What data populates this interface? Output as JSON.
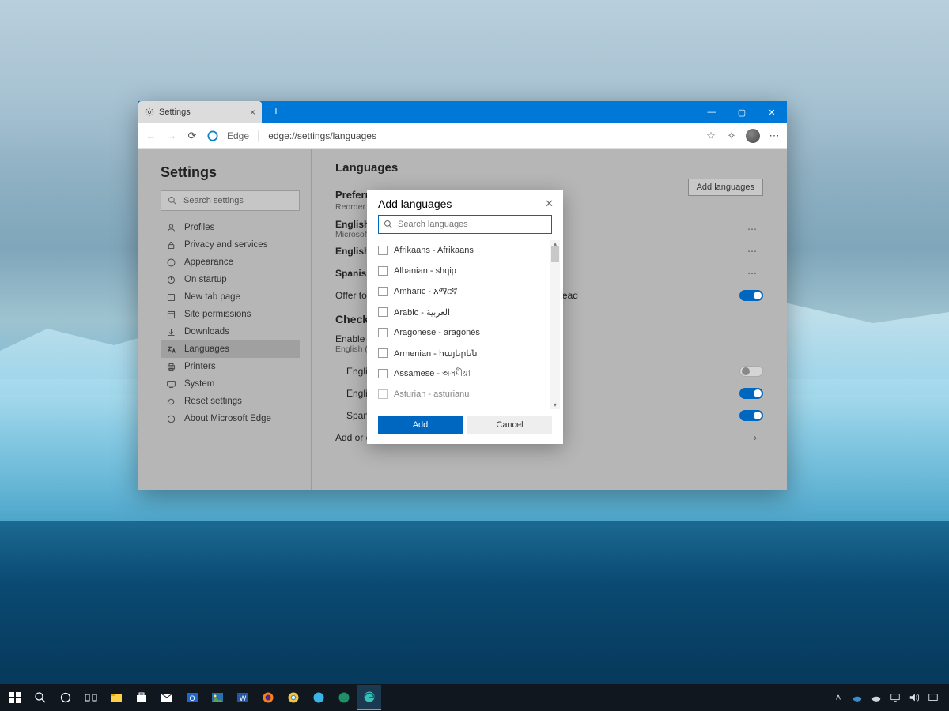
{
  "tab": {
    "title": "Settings"
  },
  "addressbar": {
    "app_label": "Edge",
    "url": "edge://settings/languages"
  },
  "sidebar": {
    "title": "Settings",
    "search_placeholder": "Search settings",
    "items": [
      {
        "label": "Profiles"
      },
      {
        "label": "Privacy and services"
      },
      {
        "label": "Appearance"
      },
      {
        "label": "On startup"
      },
      {
        "label": "New tab page"
      },
      {
        "label": "Site permissions"
      },
      {
        "label": "Downloads"
      },
      {
        "label": "Languages"
      },
      {
        "label": "Printers"
      },
      {
        "label": "System"
      },
      {
        "label": "Reset settings"
      },
      {
        "label": "About Microsoft Edge"
      }
    ]
  },
  "main": {
    "heading": "Languages",
    "preferred_heading": "Preferred languages",
    "preferred_sub": "Reorder languages based on your preference",
    "add_button": "Add languages",
    "langs": [
      {
        "label": "English (United States)",
        "sub": "Microsoft Edge display language"
      },
      {
        "label": "English"
      },
      {
        "label": "Spanish"
      }
    ],
    "offer_translate": "Offer to translate pages that aren't in a language you read",
    "spelling_heading": "Check spelling",
    "enable_label": "Enable spell check",
    "enable_sub": "English (United States)",
    "spell_langs": [
      {
        "label": "English (United States)",
        "toggle": "off"
      },
      {
        "label": "English",
        "toggle": "on"
      },
      {
        "label": "Spanish",
        "toggle": "on"
      }
    ],
    "add_words": "Add or delete words"
  },
  "dialog": {
    "title": "Add languages",
    "search_placeholder": "Search languages",
    "items": [
      "Afrikaans - Afrikaans",
      "Albanian - shqip",
      "Amharic - አማርኛ",
      "Arabic - العربية",
      "Aragonese - aragonés",
      "Armenian - հայերեն",
      "Assamese - অসমীয়া",
      "Asturian - asturianu"
    ],
    "add": "Add",
    "cancel": "Cancel"
  }
}
